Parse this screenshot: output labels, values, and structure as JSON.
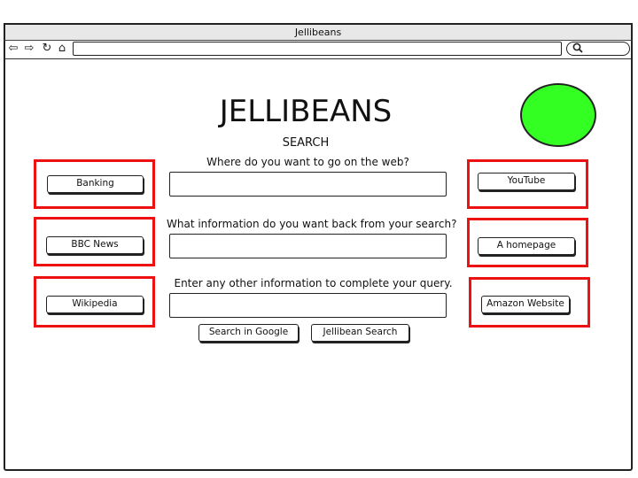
{
  "window": {
    "title": "Jellibeans"
  },
  "toolbar": {
    "back_icon": "back-arrow-icon",
    "forward_icon": "forward-arrow-icon",
    "reload_icon": "reload-icon",
    "home_icon": "home-icon",
    "search_icon": "search-icon",
    "url_value": ""
  },
  "page": {
    "logo": "JELLIBEANS",
    "subtitle": "SEARCH",
    "accent_circle_color": "#33ff22",
    "highlight_color": "#ee1111"
  },
  "form": {
    "q1_label": "Where do you want to go on the web?",
    "q2_label": "What information do you want back from your search?",
    "q3_label": "Enter any other information to complete your query.",
    "q1_value": "",
    "q2_value": "",
    "q3_value": "",
    "search_google_label": "Search in Google",
    "jellibean_search_label": "Jellibean Search"
  },
  "shortcuts": {
    "left": [
      "Banking",
      "BBC News",
      "Wikipedia"
    ],
    "right": [
      "YouTube",
      "A homepage",
      "Amazon Website"
    ]
  }
}
